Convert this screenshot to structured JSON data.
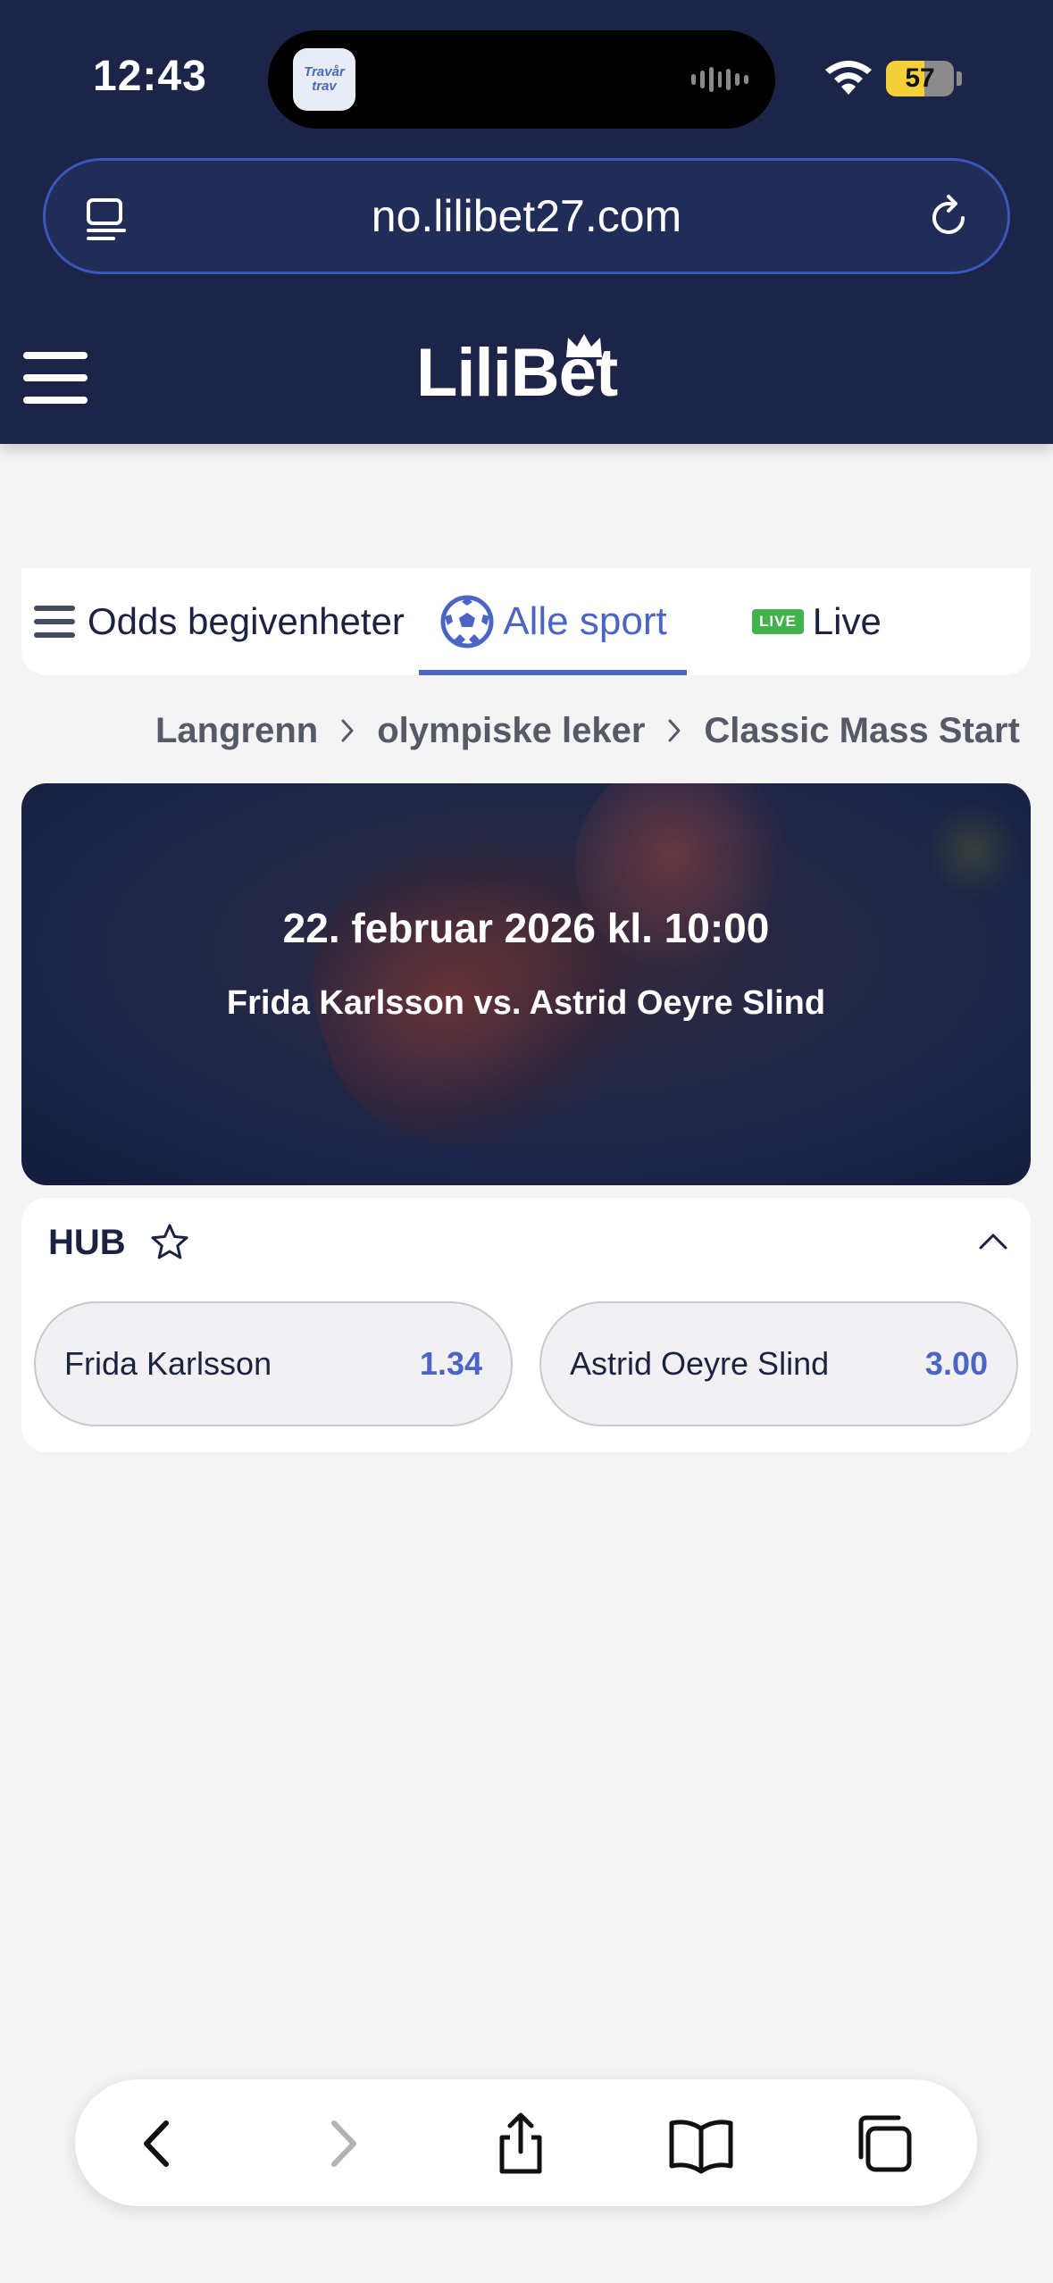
{
  "status_bar": {
    "time": "12:43",
    "island_app_label": "Travår trav",
    "battery_percent": "57",
    "battery_level": 0.57,
    "icons": [
      "wifi-icon",
      "battery-icon"
    ]
  },
  "browser": {
    "url": "no.lilibet27.com",
    "icons": [
      "tab-overview-icon",
      "reload-icon"
    ]
  },
  "site_header": {
    "logo_text": "LiliBet",
    "icons": [
      "hamburger-menu-icon",
      "crown-icon"
    ],
    "colors": {
      "header_bg": "#1c2548",
      "accent": "#4c64c4"
    }
  },
  "tabs": [
    {
      "label": "Odds begivenheter",
      "icon": "list-icon",
      "active": false
    },
    {
      "label": "Alle sport",
      "icon": "soccer-ball-icon",
      "active": true
    },
    {
      "label": "Live",
      "badge": "LIVE",
      "active": false
    }
  ],
  "breadcrumb": [
    "Langrenn",
    "olympiske leker",
    "Classic Mass Start"
  ],
  "event": {
    "datetime": "22. februar 2026 kl. 10:00",
    "matchup": "Frida Karlsson vs. Astrid Oeyre Slind"
  },
  "market": {
    "title": "HUB",
    "outcomes": [
      {
        "name": "Frida Karlsson",
        "odds": "1.34"
      },
      {
        "name": "Astrid Oeyre Slind",
        "odds": "3.00"
      }
    ]
  },
  "bottom_toolbar": {
    "icons": [
      "back-icon",
      "forward-icon",
      "share-icon",
      "bookmarks-icon",
      "tabs-icon"
    ]
  }
}
